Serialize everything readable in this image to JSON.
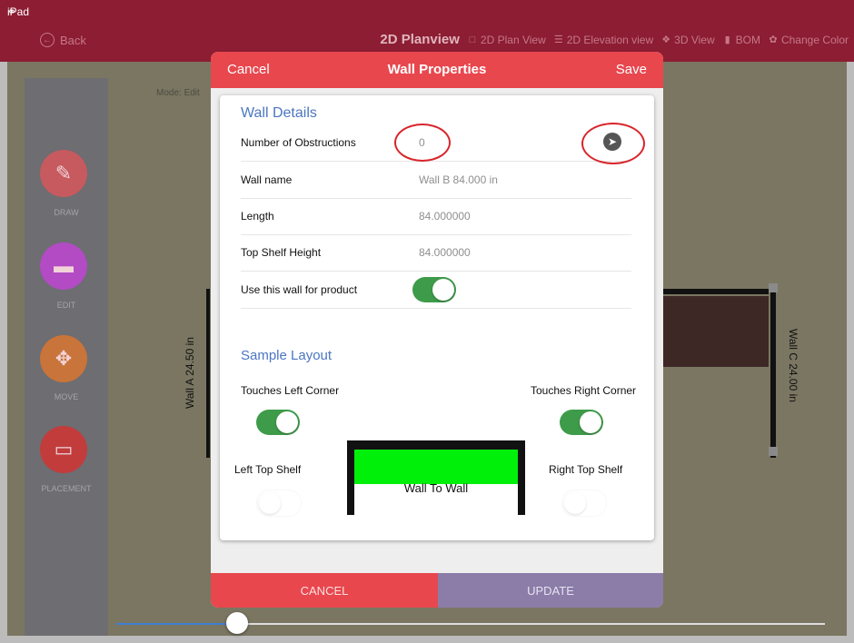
{
  "status_bar": {
    "carrier": "iPad",
    "wifi_icon": "wifi-icon"
  },
  "topbar": {
    "back_label": "Back",
    "title": "2D Planview",
    "nav": [
      {
        "icon": "plan-view-icon",
        "label": "2D Plan View"
      },
      {
        "icon": "list-icon",
        "label": "2D Elevation view"
      },
      {
        "icon": "cube-icon",
        "label": "3D View"
      },
      {
        "icon": "document-icon",
        "label": "BOM"
      },
      {
        "icon": "palette-icon",
        "label": "Change Color"
      }
    ]
  },
  "sidebar": {
    "tools": [
      {
        "label": "DRAW",
        "icon": "pencil-icon",
        "color": "#c65a5f"
      },
      {
        "label": "EDIT",
        "icon": "ruler-icon",
        "color": "#b24bc4"
      },
      {
        "label": "MOVE",
        "icon": "move-arrows-icon",
        "color": "#c9743a"
      },
      {
        "label": "PLACEMENT",
        "icon": "placement-icon",
        "color": "#c23c3c"
      }
    ]
  },
  "canvas": {
    "mode_label": "Mode: Edit",
    "wall_a_label": "Wall A 24.50 in",
    "wall_c_label": "Wall C 24.00 in"
  },
  "zoom_slider": {
    "value_fraction": 0.17
  },
  "modal": {
    "cancel_label": "Cancel",
    "title": "Wall Properties",
    "save_label": "Save",
    "wall_details_header": "Wall Details",
    "rows": {
      "obstructions": {
        "label": "Number of Obstructions",
        "value": "0"
      },
      "wall_name": {
        "label": "Wall name",
        "value": "Wall B 84.000 in"
      },
      "length": {
        "label": "Length",
        "value": "84.000000"
      },
      "top_shelf_height": {
        "label": "Top Shelf Height",
        "value": "84.000000"
      },
      "use_wall": {
        "label": "Use this wall for product",
        "on": true
      }
    },
    "sample_layout_header": "Sample Layout",
    "touches_left_corner": {
      "label": "Touches Left Corner",
      "on": true
    },
    "touches_right_corner": {
      "label": "Touches Right Corner",
      "on": true
    },
    "left_top_shelf": {
      "label": "Left Top Shelf",
      "on": false
    },
    "right_top_shelf": {
      "label": "Right Top Shelf",
      "on": false
    },
    "diagram_label": "Wall To Wall",
    "footer_cancel": "CANCEL",
    "footer_update": "UPDATE"
  },
  "colors": {
    "brand": "#8c1d33",
    "accent_red": "#e8474e",
    "toggle_on": "#3e9b4a",
    "update_purple": "#8b7ca8",
    "diagram_fill": "#00f00a",
    "section_blue": "#4b76c2"
  }
}
